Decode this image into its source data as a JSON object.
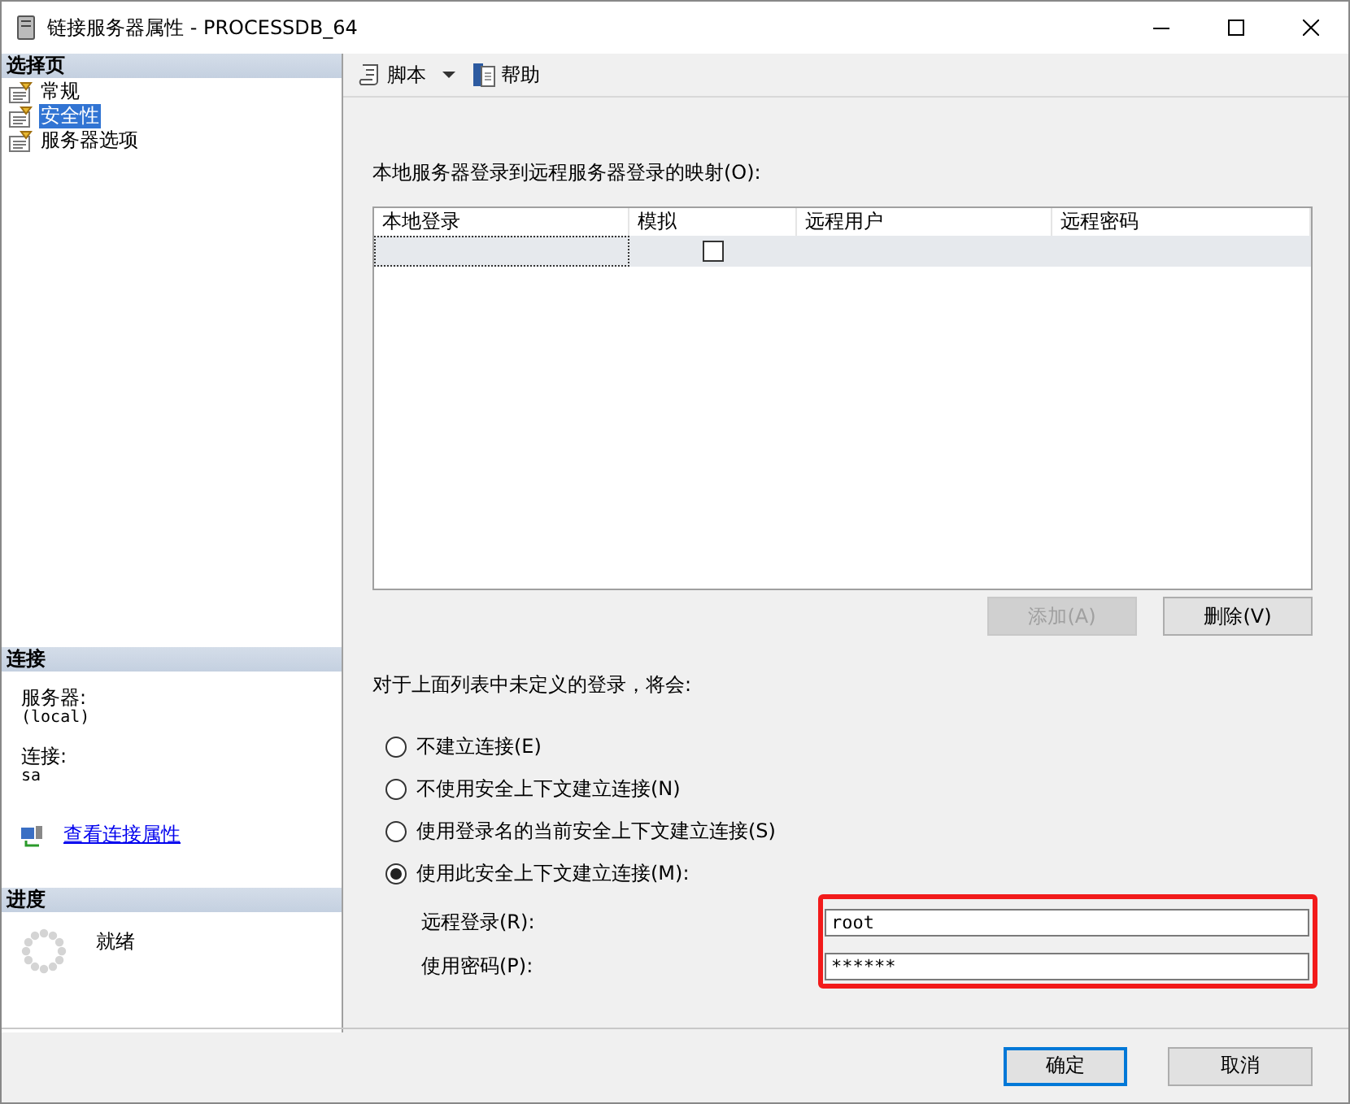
{
  "window": {
    "title": "链接服务器属性 - PROCESSDB_64"
  },
  "sidebar": {
    "header": "选择页",
    "pages": [
      {
        "label": "常规",
        "selected": false
      },
      {
        "label": "安全性",
        "selected": true
      },
      {
        "label": "服务器选项",
        "selected": false
      }
    ]
  },
  "connection": {
    "header": "连接",
    "server_label": "服务器:",
    "server_value": "(local)",
    "conn_label": "连接:",
    "conn_value": "sa",
    "link": "查看连接属性"
  },
  "progress": {
    "header": "进度",
    "status": "就绪"
  },
  "toolbar": [
    {
      "label": "脚本",
      "kind": "script"
    },
    {
      "label": "帮助",
      "kind": "help"
    }
  ],
  "mapping": {
    "label": "本地服务器登录到远程服务器登录的映射(O):",
    "columns": [
      "本地登录",
      "模拟",
      "远程用户",
      "远程密码"
    ],
    "rows": [
      {
        "impersonate": false
      }
    ],
    "add_button": {
      "label": "添加(A)",
      "disabled": true
    },
    "delete_button": {
      "label": "删除(V)",
      "disabled": false
    }
  },
  "undefined_label": "对于上面列表中未定义的登录，将会:",
  "options": [
    {
      "label": "不建立连接(E)",
      "selected": false
    },
    {
      "label": "不使用安全上下文建立连接(N)",
      "selected": false
    },
    {
      "label": "使用登录名的当前安全上下文建立连接(S)",
      "selected": false
    },
    {
      "label": "使用此安全上下文建立连接(M):",
      "selected": true
    }
  ],
  "remote_login": {
    "label": "远程登录(R):",
    "value": "root"
  },
  "password": {
    "label": "使用密码(P):",
    "value": "******"
  },
  "footer": [
    {
      "label": "确定",
      "default": true
    },
    {
      "label": "取消",
      "default": false
    }
  ]
}
